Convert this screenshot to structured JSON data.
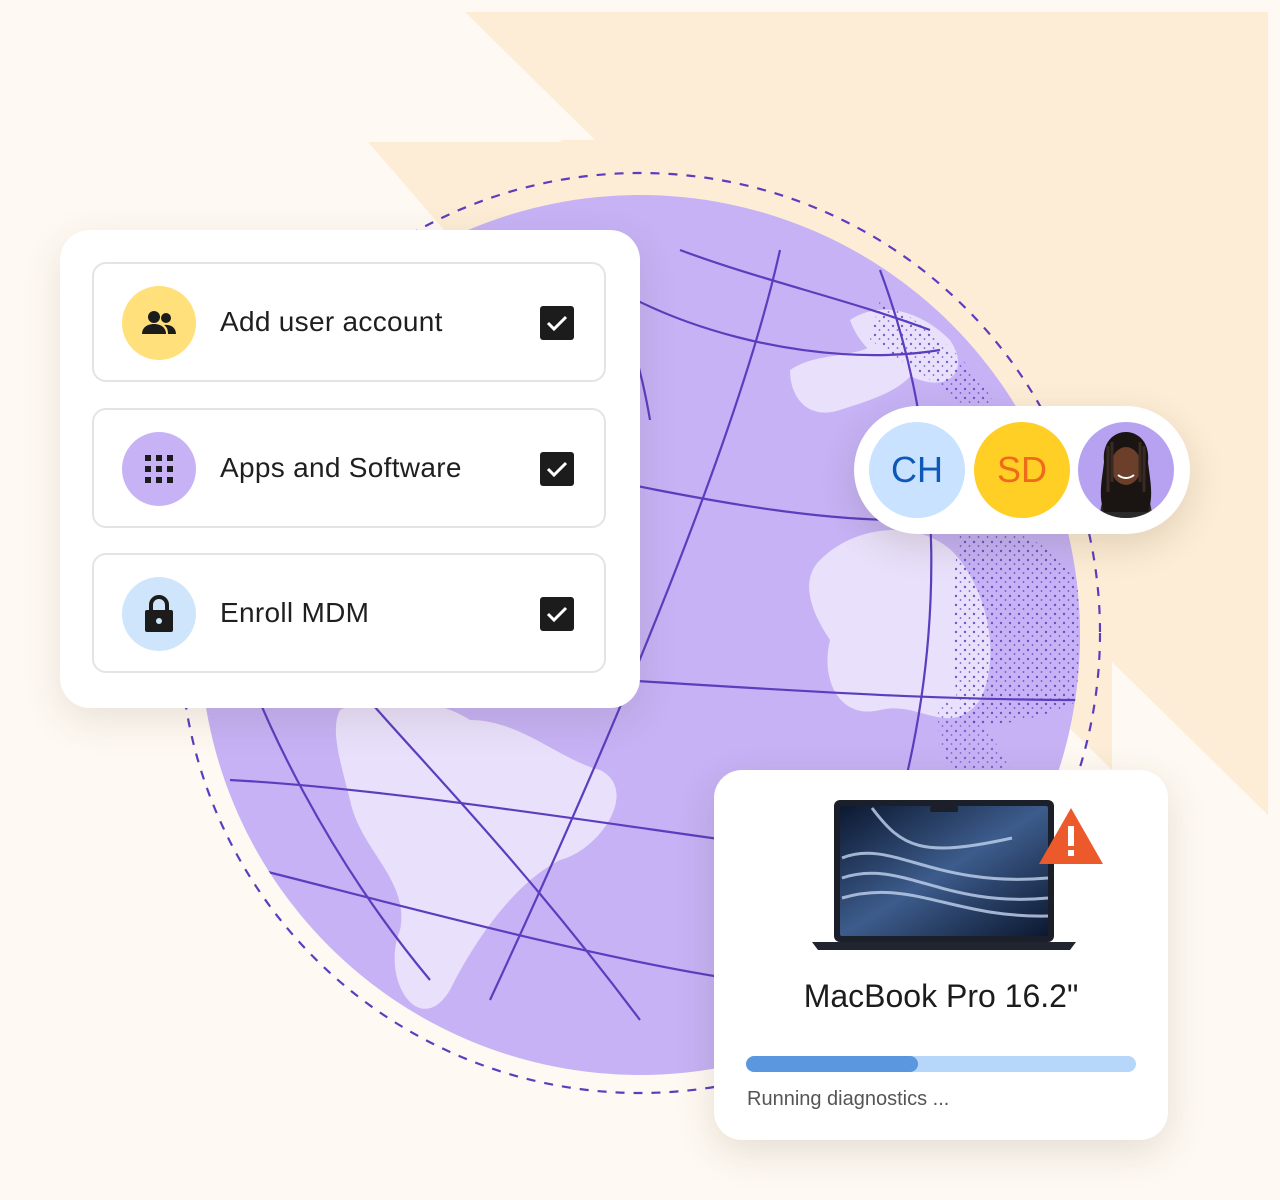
{
  "tasks": [
    {
      "label": "Add user account",
      "icon": "users-icon",
      "icon_bg": "#FFE07A",
      "checked": true
    },
    {
      "label": "Apps and Software",
      "icon": "app-grid-icon",
      "icon_bg": "#C7B2F6",
      "checked": true
    },
    {
      "label": "Enroll MDM",
      "icon": "lock-icon",
      "icon_bg": "#CFE5FB",
      "checked": true
    }
  ],
  "avatars": [
    {
      "initials": "CH",
      "bg": "#C8E2FF",
      "color": "#0D58B8"
    },
    {
      "initials": "SD",
      "bg": "#FFCF26",
      "color": "#EF6A1B"
    },
    {
      "type": "photo",
      "bg": "#B7A2F2"
    }
  ],
  "device": {
    "name": "MacBook Pro 16.2\"",
    "progress": 0.44,
    "status": "Running diagnostics ...",
    "warning_icon": "warning-triangle-icon",
    "warning_color": "#EC5A2C"
  },
  "colors": {
    "background": "#FEF9F2",
    "globe_land": "#E9E0FB",
    "globe_ocean": "#C6B2F5",
    "globe_lines": "#5B3DBE",
    "progress_fill": "#5A97DE",
    "progress_track": "#B6D7FA"
  }
}
